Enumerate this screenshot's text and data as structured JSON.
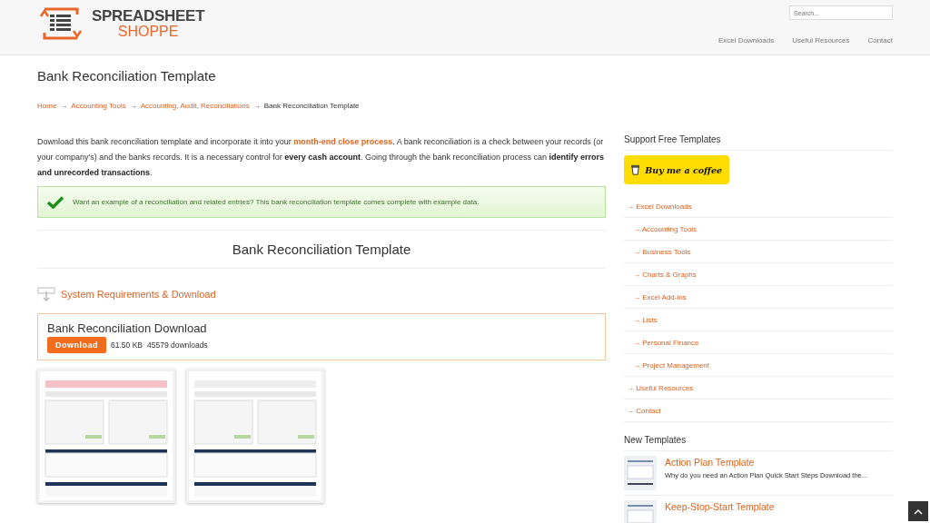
{
  "header": {
    "logo": {
      "line1": "SPREADSHEET",
      "line2": "SHOPPE"
    },
    "search": {
      "placeholder": "Search..."
    },
    "nav": [
      "Excel Downloads",
      "Useful Resources",
      "Contact"
    ]
  },
  "page_title": "Bank Reconciliation Template",
  "breadcrumb": [
    {
      "label": "Home",
      "kind": "link"
    },
    {
      "label": "Accounting Tools",
      "kind": "link"
    },
    {
      "label": "Accounting, Audit, Reconciliations",
      "kind": "link"
    },
    {
      "label": "Bank Reconciliation Template",
      "kind": "current"
    }
  ],
  "breadcrumb_separator": "→",
  "intro": [
    {
      "kind": "text",
      "text": "Download this bank reconciliation template and incorporate it into your "
    },
    {
      "kind": "link",
      "text": "month-end close process"
    },
    {
      "kind": "text",
      "text": ". A bank reconciliation is a check between your records (or your company's) and the banks records.  It is a necessary control for "
    },
    {
      "kind": "bold",
      "text": "every cash account"
    },
    {
      "kind": "text",
      "text": ".  Going through the bank reconciliation process can "
    },
    {
      "kind": "bold",
      "text": "identify errors and unrecorded transactions"
    },
    {
      "kind": "text",
      "text": "."
    }
  ],
  "notice": "Want an example of a reconciliation and related entries?  This bank reconciliation template comes complete with example data.",
  "section_heading": "Bank Reconciliation Template",
  "requirements_heading": "System Requirements & Download",
  "download_box": {
    "title": "Bank Reconciliation Download",
    "button": "Download",
    "size": "61.50 KB",
    "downloads": "45579 downloads"
  },
  "sidebar": {
    "support_heading": "Support Free Templates",
    "coffee_button": "Buy me a coffee",
    "menu": [
      {
        "label": "Excel Downloads",
        "children": [
          {
            "label": "Accounting Tools"
          },
          {
            "label": "Business Tools"
          },
          {
            "label": "Charts & Graphs"
          },
          {
            "label": "Excel Add-ins"
          },
          {
            "label": "Lists"
          },
          {
            "label": "Personal Finance"
          },
          {
            "label": "Project Management"
          }
        ]
      },
      {
        "label": "Useful Resources"
      },
      {
        "label": "Contact"
      }
    ],
    "menu_bullet": "→",
    "new_heading": "New Templates",
    "new_templates": [
      {
        "title": "Action Plan Template",
        "excerpt": "Why do you need an Action Plan   Quick Start Steps Download the..."
      },
      {
        "title": "Keep-Stop-Start Template"
      }
    ]
  }
}
